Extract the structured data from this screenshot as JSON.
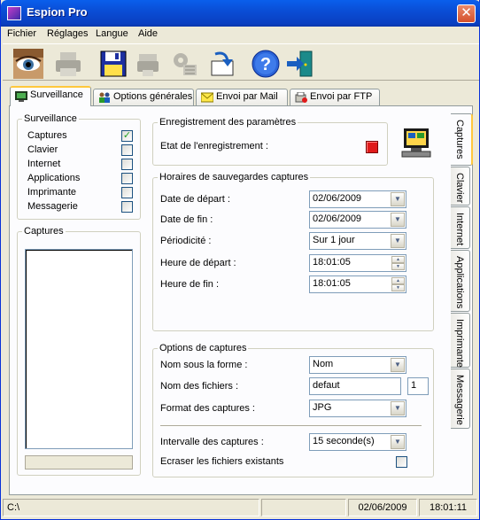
{
  "window": {
    "title": "Espion Pro",
    "close_glyph": "✕"
  },
  "menu": [
    "Fichier",
    "Réglages",
    "Langue",
    "Aide"
  ],
  "toolbar": {
    "buttons": [
      {
        "name": "eye-icon",
        "enabled": true
      },
      {
        "name": "printer-icon",
        "enabled": false
      },
      {
        "name": "floppy-disk-icon",
        "enabled": true
      },
      {
        "name": "printer-stack-icon",
        "enabled": false
      },
      {
        "name": "gears-icon",
        "enabled": false
      },
      {
        "name": "download-arrow-icon",
        "enabled": true
      },
      {
        "name": "help-icon",
        "enabled": true
      },
      {
        "name": "exit-door-icon",
        "enabled": true
      }
    ]
  },
  "tabs": [
    {
      "label": "Surveillance",
      "icon": "monitor-icon",
      "active": true
    },
    {
      "label": "Options générales",
      "icon": "users-icon",
      "active": false
    },
    {
      "label": "Envoi par Mail",
      "icon": "mail-icon",
      "active": false
    },
    {
      "label": "Envoi par FTP",
      "icon": "ftp-icon",
      "active": false
    }
  ],
  "surveillance": {
    "legend": "Surveillance",
    "items": [
      {
        "label": "Captures",
        "checked": true
      },
      {
        "label": "Clavier",
        "checked": false
      },
      {
        "label": "Internet",
        "checked": false
      },
      {
        "label": "Applications",
        "checked": false
      },
      {
        "label": "Imprimante",
        "checked": false
      },
      {
        "label": "Messagerie",
        "checked": false
      }
    ],
    "check_glyph": "✓"
  },
  "captures_box": {
    "legend": "Captures"
  },
  "enregistrement": {
    "legend": "Enregistrement des paramètres",
    "state_label": "Etat de l'enregistrement :"
  },
  "horaires": {
    "legend": "Horaires de sauvegardes captures",
    "date_depart_label": "Date de départ :",
    "date_depart_value": "02/06/2009",
    "date_fin_label": "Date de fin :",
    "date_fin_value": "02/06/2009",
    "periodicite_label": "Périodicité :",
    "periodicite_value": "Sur 1 jour",
    "heure_depart_label": "Heure de départ :",
    "heure_depart_value": "18:01:05",
    "heure_fin_label": "Heure de fin :",
    "heure_fin_value": "18:01:05"
  },
  "options_captures": {
    "legend": "Options de captures",
    "nom_forme_label": "Nom sous la forme :",
    "nom_forme_value": "Nom",
    "nom_fichiers_label": "Nom des fichiers :",
    "nom_fichiers_value": "defaut",
    "nom_fichiers_index": "1",
    "format_label": "Format des captures :",
    "format_value": "JPG",
    "intervalle_label": "Intervalle des captures :",
    "intervalle_value": "15 seconde(s)",
    "ecraser_label": "Ecraser les fichiers existants",
    "ecraser_checked": false
  },
  "vertical_tabs": [
    "Captures",
    "Clavier",
    "Internet",
    "Applications",
    "Imprimante",
    "Messagerie"
  ],
  "status": {
    "path": "C:\\",
    "date": "02/06/2009",
    "time": "18:01:11"
  },
  "colors": {
    "titlebar": "#0A4ED6",
    "record": "#E01A1A",
    "tab_highlight": "#FFC83C"
  }
}
